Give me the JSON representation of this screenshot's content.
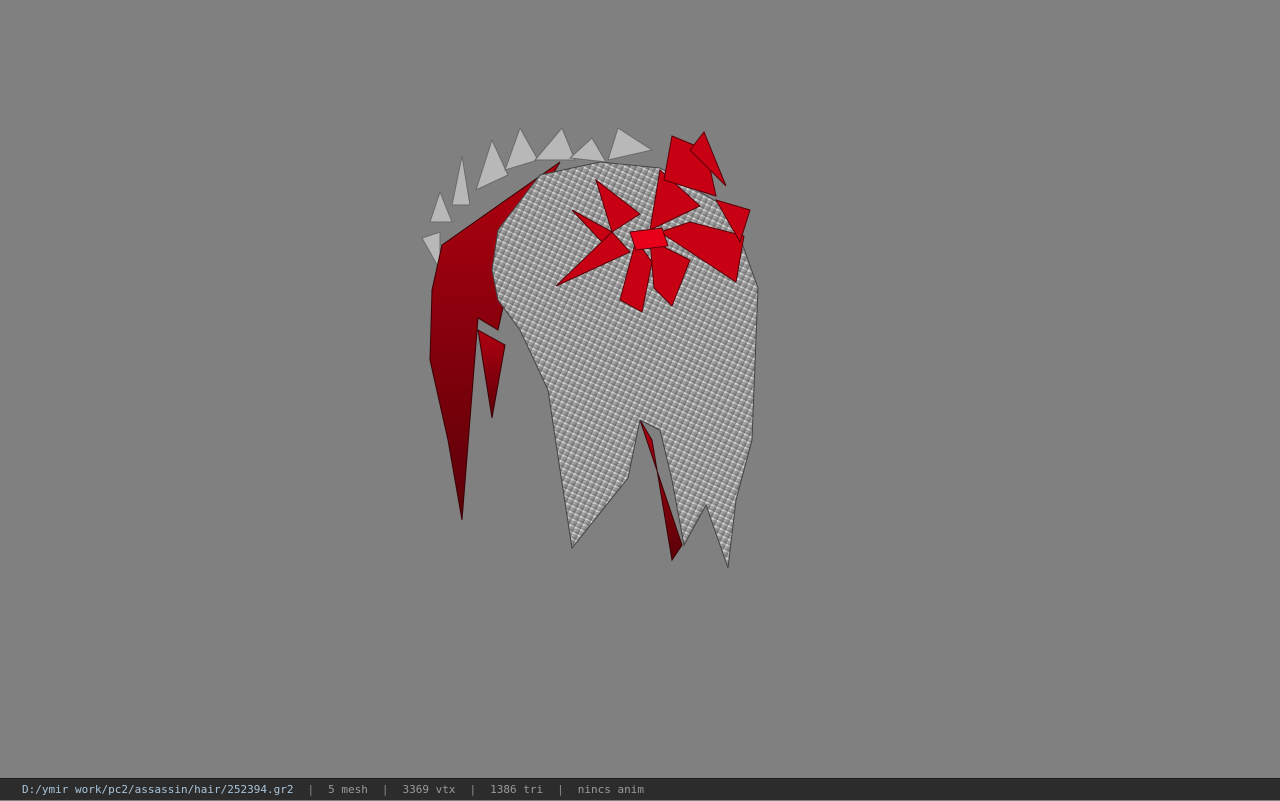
{
  "viewer": {
    "background_color": "#808080",
    "model_icon": "3d-hair-model"
  },
  "status_bar": {
    "file_path": "D:/ymir work/pc2/assassin/hair/252394.gr2",
    "separator": "|",
    "mesh_count": "5 mesh",
    "vertex_count": "3369 vtx",
    "triangle_count": "1386 tri",
    "anim_status": "nincs anim"
  }
}
